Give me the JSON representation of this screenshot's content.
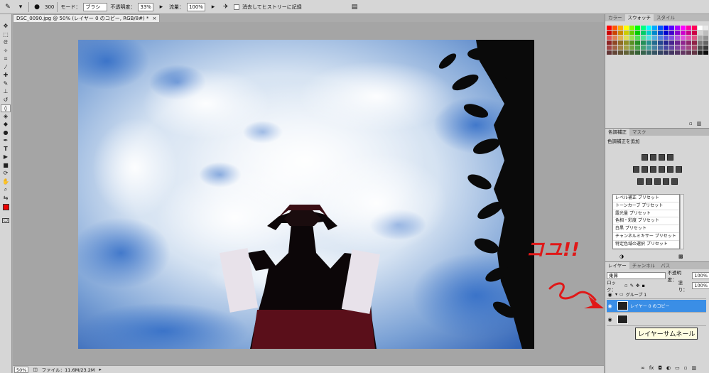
{
  "options_bar": {
    "brush_size": "300",
    "mode_label": "モード：",
    "mode_value": "ブラシ",
    "opacity_label": "不透明度：",
    "opacity_value": "33%",
    "flow_label": "流量：",
    "flow_value": "100%",
    "history_checkbox_label": "消去してヒストリーに記録"
  },
  "document": {
    "tab_title": "DSC_0090.jpg @ 50% (レイヤー 0 のコピー, RGB/8#) *",
    "tab_close": "×"
  },
  "status_bar": {
    "zoom": "50%",
    "file_info": "ファイル：11.6M/23.2M"
  },
  "swatches_panel": {
    "tabs": [
      "カラー",
      "スウォッチ",
      "スタイル"
    ],
    "active_tab": "スウォッチ"
  },
  "adjustments_panel": {
    "tabs": [
      "色調補正",
      "マスク"
    ],
    "title": "色調補正を追加",
    "presets": [
      "レベル補正 プリセット",
      "トーンカーブ プリセット",
      "露光量 プリセット",
      "色相・彩度 プリセット",
      "白黒 プリセット",
      "チャンネルミキサー プリセット",
      "特定色域の選択 プリセット"
    ]
  },
  "layers_panel": {
    "tabs": [
      "レイヤー",
      "チャンネル",
      "パス"
    ],
    "blend_mode": "乗算",
    "opacity_label": "不透明度：",
    "opacity_value": "100%",
    "lock_label": "ロック：",
    "fill_label": "塗り：",
    "fill_value": "100%",
    "layers": [
      {
        "name": "グループ 1"
      },
      {
        "name": "レイヤー 0 のコピー"
      },
      {
        "name": ""
      }
    ],
    "tooltip": "レイヤーサムネール"
  },
  "annotation": {
    "text": "コユ!!"
  },
  "colors": {
    "accent_red": "#e01818",
    "selection_blue": "#3a8ee6",
    "foreground_color": "#ee0000"
  }
}
